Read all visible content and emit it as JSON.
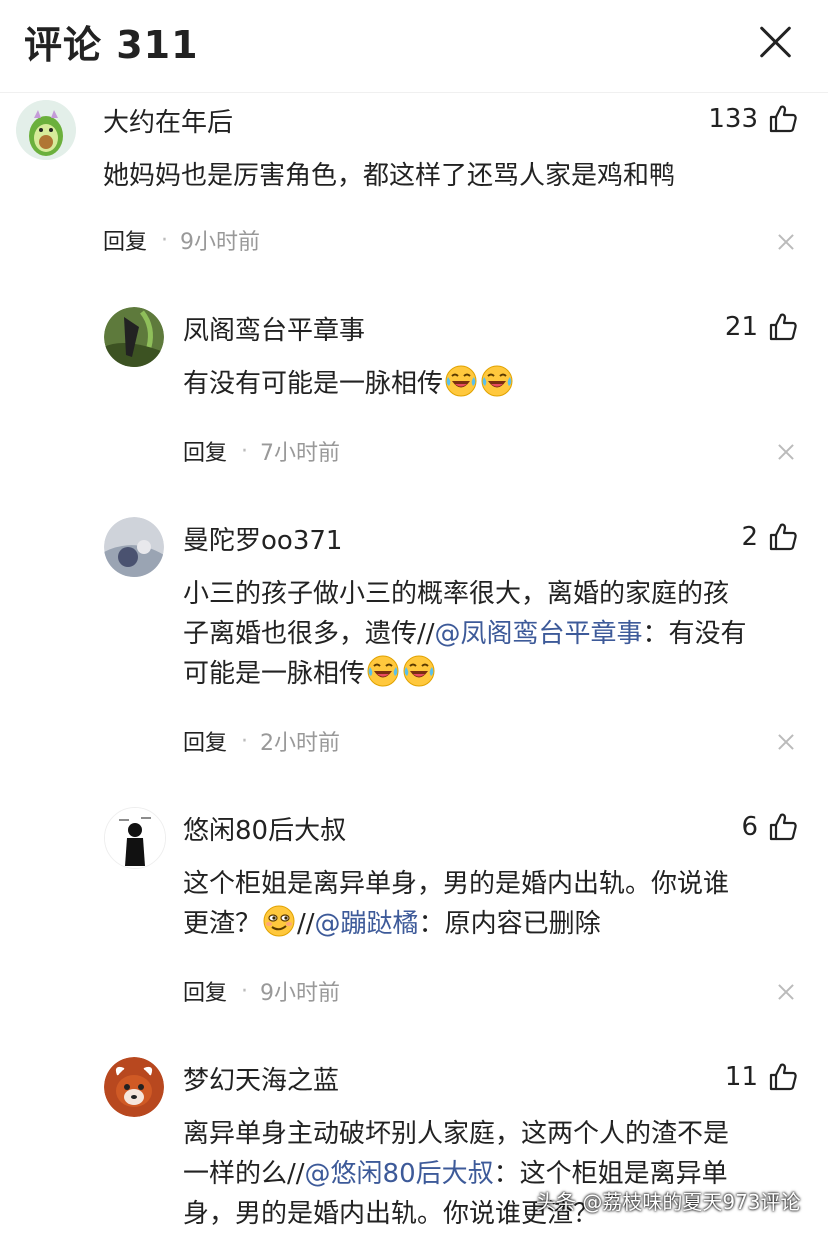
{
  "header": {
    "title": "评论 311"
  },
  "comments": [
    {
      "name": "大约在年后",
      "likes": "133",
      "text": "她妈妈也是厉害角色，都这样了还骂人家是鸡和鸭",
      "reply": "回复",
      "sep": "·",
      "time": "9小时前"
    },
    {
      "name": "凤阁鸾台平章事",
      "likes": "21",
      "text": "有没有可能是一脉相传",
      "reply": "回复",
      "sep": "·",
      "time": "7小时前"
    },
    {
      "name": "曼陀罗oo371",
      "likes": "2",
      "text_a": "小三的孩子做小三的概率很大，离婚的家庭的孩",
      "text_b": "子离婚也很多，遗传//",
      "mention": "@凤阁鸾台平章事",
      "text_c": "：有没有",
      "text_d": "可能是一脉相传",
      "reply": "回复",
      "sep": "·",
      "time": "2小时前"
    },
    {
      "name": "悠闲80后大叔",
      "likes": "6",
      "text_a": "这个柜姐是离异单身，男的是婚内出轨。你说谁",
      "text_b": "更渣？",
      "text_c": "//",
      "mention": "@蹦跶橘",
      "text_d": "：原内容已删除",
      "reply": "回复",
      "sep": "·",
      "time": "9小时前"
    },
    {
      "name": "梦幻天海之蓝",
      "likes": "11",
      "text_a": "离异单身主动破坏别人家庭，这两个人的渣不是",
      "text_b": "一样的么//",
      "mention": "@悠闲80后大叔",
      "text_c": "：这个柜姐是离异单",
      "text_d": "身，男的是婚内出轨。你说谁更渣？"
    }
  ],
  "watermark": "头条 @荔枝味的夏天973评论",
  "icons": {
    "like": "thumbs-up-icon",
    "close": "close-icon",
    "dismiss": "dismiss-icon",
    "emoji_laugh": "laugh-cry-emoji",
    "emoji_smirk": "smirk-emoji"
  },
  "colors": {
    "mention": "#3d5a99",
    "meta": "#999999",
    "text": "#222222"
  }
}
